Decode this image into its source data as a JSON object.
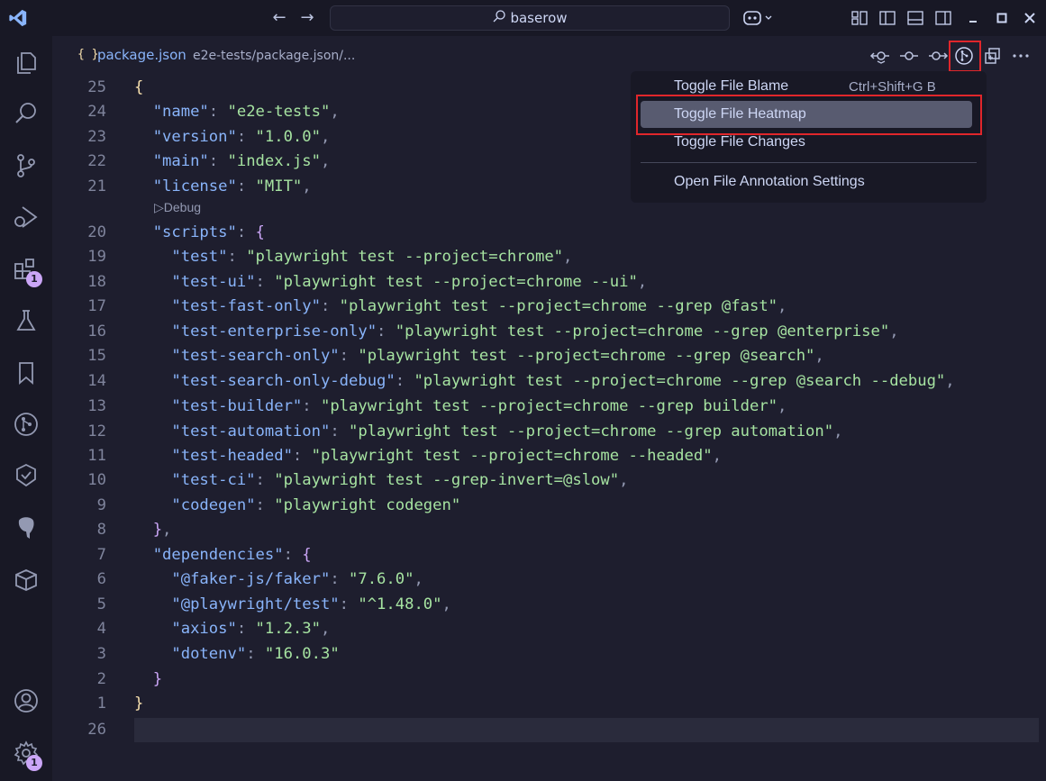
{
  "titlebar": {
    "search_text": "baserow",
    "back_icon": "arrow-left-icon",
    "forward_icon": "arrow-right-icon",
    "copilot_icon": "copilot-icon",
    "layout_icons": [
      "customize-layout-icon",
      "toggle-primary-sidebar-icon",
      "toggle-panel-icon",
      "toggle-secondary-sidebar-icon"
    ],
    "window_controls": [
      "minimize-icon",
      "maximize-icon",
      "close-icon"
    ]
  },
  "activitybar": {
    "items": [
      {
        "name": "explorer-icon"
      },
      {
        "name": "search-icon"
      },
      {
        "name": "source-control-icon"
      },
      {
        "name": "run-debug-icon"
      },
      {
        "name": "extensions-icon",
        "badge": "1"
      },
      {
        "name": "testing-icon"
      },
      {
        "name": "bookmarks-icon"
      },
      {
        "name": "gitlens-icon"
      },
      {
        "name": "gitlens-inspect-icon"
      },
      {
        "name": "postgres-icon"
      },
      {
        "name": "containers-icon"
      }
    ],
    "bottom": [
      {
        "name": "accounts-icon"
      },
      {
        "name": "manage-gear-icon",
        "badge": "1"
      }
    ]
  },
  "tab": {
    "icon_text": "{ }",
    "filename": "package.json",
    "path": "e2e-tests/package.json/..."
  },
  "editor_actions": [
    "compare-with-previous-icon",
    "open-changes-icon",
    "open-changes-next-icon",
    "gitlens-file-annotations-icon",
    "open-changes-working-icon",
    "more-actions-icon"
  ],
  "codelens": "Debug",
  "code_lines": [
    {
      "n": "25",
      "segs": [
        {
          "c": "b1",
          "t": "{"
        }
      ]
    },
    {
      "n": "24",
      "segs": [
        {
          "c": "k",
          "t": "  \"name\""
        },
        {
          "c": "p",
          "t": ": "
        },
        {
          "c": "s",
          "t": "\"e2e-tests\""
        },
        {
          "c": "p",
          "t": ","
        }
      ]
    },
    {
      "n": "23",
      "segs": [
        {
          "c": "k",
          "t": "  \"version\""
        },
        {
          "c": "p",
          "t": ": "
        },
        {
          "c": "s",
          "t": "\"1.0.0\""
        },
        {
          "c": "p",
          "t": ","
        }
      ]
    },
    {
      "n": "22",
      "segs": [
        {
          "c": "k",
          "t": "  \"main\""
        },
        {
          "c": "p",
          "t": ": "
        },
        {
          "c": "s",
          "t": "\"index.js\""
        },
        {
          "c": "p",
          "t": ","
        }
      ]
    },
    {
      "n": "21",
      "segs": [
        {
          "c": "k",
          "t": "  \"license\""
        },
        {
          "c": "p",
          "t": ": "
        },
        {
          "c": "s",
          "t": "\"MIT\""
        },
        {
          "c": "p",
          "t": ","
        }
      ]
    },
    {
      "n": "20",
      "segs": [
        {
          "c": "k",
          "t": "  \"scripts\""
        },
        {
          "c": "p",
          "t": ": "
        },
        {
          "c": "b2",
          "t": "{"
        }
      ]
    },
    {
      "n": "19",
      "segs": [
        {
          "c": "k",
          "t": "    \"test\""
        },
        {
          "c": "p",
          "t": ": "
        },
        {
          "c": "s",
          "t": "\"playwright test --project=chrome\""
        },
        {
          "c": "p",
          "t": ","
        }
      ]
    },
    {
      "n": "18",
      "segs": [
        {
          "c": "k",
          "t": "    \"test-ui\""
        },
        {
          "c": "p",
          "t": ": "
        },
        {
          "c": "s",
          "t": "\"playwright test --project=chrome --ui\""
        },
        {
          "c": "p",
          "t": ","
        }
      ]
    },
    {
      "n": "17",
      "segs": [
        {
          "c": "k",
          "t": "    \"test-fast-only\""
        },
        {
          "c": "p",
          "t": ": "
        },
        {
          "c": "s",
          "t": "\"playwright test --project=chrome --grep @fast\""
        },
        {
          "c": "p",
          "t": ","
        }
      ]
    },
    {
      "n": "16",
      "segs": [
        {
          "c": "k",
          "t": "    \"test-enterprise-only\""
        },
        {
          "c": "p",
          "t": ": "
        },
        {
          "c": "s",
          "t": "\"playwright test --project=chrome --grep @enterprise\""
        },
        {
          "c": "p",
          "t": ","
        }
      ]
    },
    {
      "n": "15",
      "segs": [
        {
          "c": "k",
          "t": "    \"test-search-only\""
        },
        {
          "c": "p",
          "t": ": "
        },
        {
          "c": "s",
          "t": "\"playwright test --project=chrome --grep @search\""
        },
        {
          "c": "p",
          "t": ","
        }
      ]
    },
    {
      "n": "14",
      "segs": [
        {
          "c": "k",
          "t": "    \"test-search-only-debug\""
        },
        {
          "c": "p",
          "t": ": "
        },
        {
          "c": "s",
          "t": "\"playwright test --project=chrome --grep @search --debug\""
        },
        {
          "c": "p",
          "t": ","
        }
      ]
    },
    {
      "n": "13",
      "segs": [
        {
          "c": "k",
          "t": "    \"test-builder\""
        },
        {
          "c": "p",
          "t": ": "
        },
        {
          "c": "s",
          "t": "\"playwright test --project=chrome --grep builder\""
        },
        {
          "c": "p",
          "t": ","
        }
      ]
    },
    {
      "n": "12",
      "segs": [
        {
          "c": "k",
          "t": "    \"test-automation\""
        },
        {
          "c": "p",
          "t": ": "
        },
        {
          "c": "s",
          "t": "\"playwright test --project=chrome --grep automation\""
        },
        {
          "c": "p",
          "t": ","
        }
      ]
    },
    {
      "n": "11",
      "segs": [
        {
          "c": "k",
          "t": "    \"test-headed\""
        },
        {
          "c": "p",
          "t": ": "
        },
        {
          "c": "s",
          "t": "\"playwright test --project=chrome --headed\""
        },
        {
          "c": "p",
          "t": ","
        }
      ]
    },
    {
      "n": "10",
      "segs": [
        {
          "c": "k",
          "t": "    \"test-ci\""
        },
        {
          "c": "p",
          "t": ": "
        },
        {
          "c": "s",
          "t": "\"playwright test --grep-invert=@slow\""
        },
        {
          "c": "p",
          "t": ","
        }
      ]
    },
    {
      "n": "9",
      "segs": [
        {
          "c": "k",
          "t": "    \"codegen\""
        },
        {
          "c": "p",
          "t": ": "
        },
        {
          "c": "s",
          "t": "\"playwright codegen\""
        }
      ]
    },
    {
      "n": "8",
      "segs": [
        {
          "c": "b2",
          "t": "  }"
        },
        {
          "c": "p",
          "t": ","
        }
      ]
    },
    {
      "n": "7",
      "segs": [
        {
          "c": "k",
          "t": "  \"dependencies\""
        },
        {
          "c": "p",
          "t": ": "
        },
        {
          "c": "b2",
          "t": "{"
        }
      ]
    },
    {
      "n": "6",
      "segs": [
        {
          "c": "k",
          "t": "    \"@faker-js/faker\""
        },
        {
          "c": "p",
          "t": ": "
        },
        {
          "c": "s",
          "t": "\"7.6.0\""
        },
        {
          "c": "p",
          "t": ","
        }
      ]
    },
    {
      "n": "5",
      "segs": [
        {
          "c": "k",
          "t": "    \"@playwright/test\""
        },
        {
          "c": "p",
          "t": ": "
        },
        {
          "c": "s",
          "t": "\"^1.48.0\""
        },
        {
          "c": "p",
          "t": ","
        }
      ]
    },
    {
      "n": "4",
      "segs": [
        {
          "c": "k",
          "t": "    \"axios\""
        },
        {
          "c": "p",
          "t": ": "
        },
        {
          "c": "s",
          "t": "\"1.2.3\""
        },
        {
          "c": "p",
          "t": ","
        }
      ]
    },
    {
      "n": "3",
      "segs": [
        {
          "c": "k",
          "t": "    \"dotenv\""
        },
        {
          "c": "p",
          "t": ": "
        },
        {
          "c": "s",
          "t": "\"16.0.3\""
        }
      ]
    },
    {
      "n": "2",
      "segs": [
        {
          "c": "b2",
          "t": "  }"
        }
      ]
    },
    {
      "n": "1",
      "segs": [
        {
          "c": "b1",
          "t": "}"
        }
      ]
    },
    {
      "n": "26",
      "segs": []
    }
  ],
  "menu": {
    "items": [
      {
        "label": "Toggle File Blame",
        "shortcut": "Ctrl+Shift+G B"
      },
      {
        "label": "Toggle File Heatmap",
        "shortcut": "",
        "selected": true
      },
      {
        "label": "Toggle File Changes",
        "shortcut": ""
      },
      {
        "label": "Open File Annotation Settings",
        "shortcut": ""
      }
    ]
  },
  "colors": {
    "editor_bg": "#1e1e2e",
    "sidebar_bg": "#181825",
    "accent": "#cba6f7",
    "highlight_box": "#e0262b",
    "key": "#89b4fa",
    "string": "#a6e3a1"
  }
}
